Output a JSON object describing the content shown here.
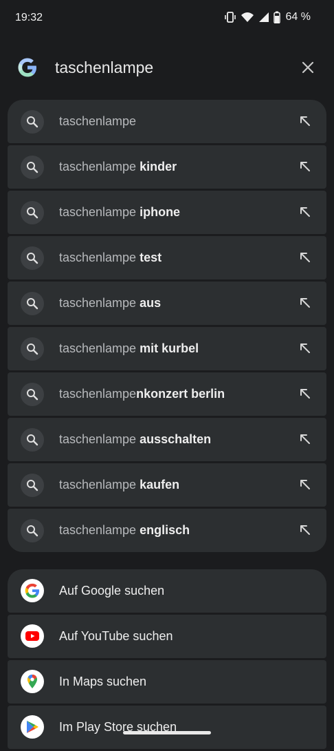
{
  "status": {
    "time": "19:32",
    "battery_pct": "64 %",
    "icons": [
      "vibrate-icon",
      "wifi-icon",
      "signal-icon",
      "battery-icon"
    ]
  },
  "search": {
    "query": "taschenlampe",
    "logo": "google-g-icon",
    "close": "close-icon"
  },
  "suggestions": [
    {
      "base": "taschenlampe",
      "completion": ""
    },
    {
      "base": "taschenlampe ",
      "completion": "kinder"
    },
    {
      "base": "taschenlampe ",
      "completion": "iphone"
    },
    {
      "base": "taschenlampe ",
      "completion": "test"
    },
    {
      "base": "taschenlampe ",
      "completion": "aus"
    },
    {
      "base": "taschenlampe ",
      "completion": "mit kurbel"
    },
    {
      "base": "taschenlampe",
      "completion": "nkonzert berlin"
    },
    {
      "base": "taschenlampe ",
      "completion": "ausschalten"
    },
    {
      "base": "taschenlampe ",
      "completion": "kaufen"
    },
    {
      "base": "taschenlampe ",
      "completion": "englisch"
    }
  ],
  "actions": [
    {
      "label": "Auf Google suchen",
      "icon": "google-icon"
    },
    {
      "label": "Auf YouTube suchen",
      "icon": "youtube-icon"
    },
    {
      "label": "In Maps suchen",
      "icon": "maps-icon"
    },
    {
      "label": "Im Play Store suchen",
      "icon": "play-store-icon"
    }
  ],
  "colors": {
    "background": "#1b1c1e",
    "row": "#2c2f31",
    "google_blue": "#4285f4",
    "google_red": "#ea4335",
    "google_yellow": "#fbbc05",
    "google_green": "#34a853",
    "youtube_red": "#ff0000"
  }
}
